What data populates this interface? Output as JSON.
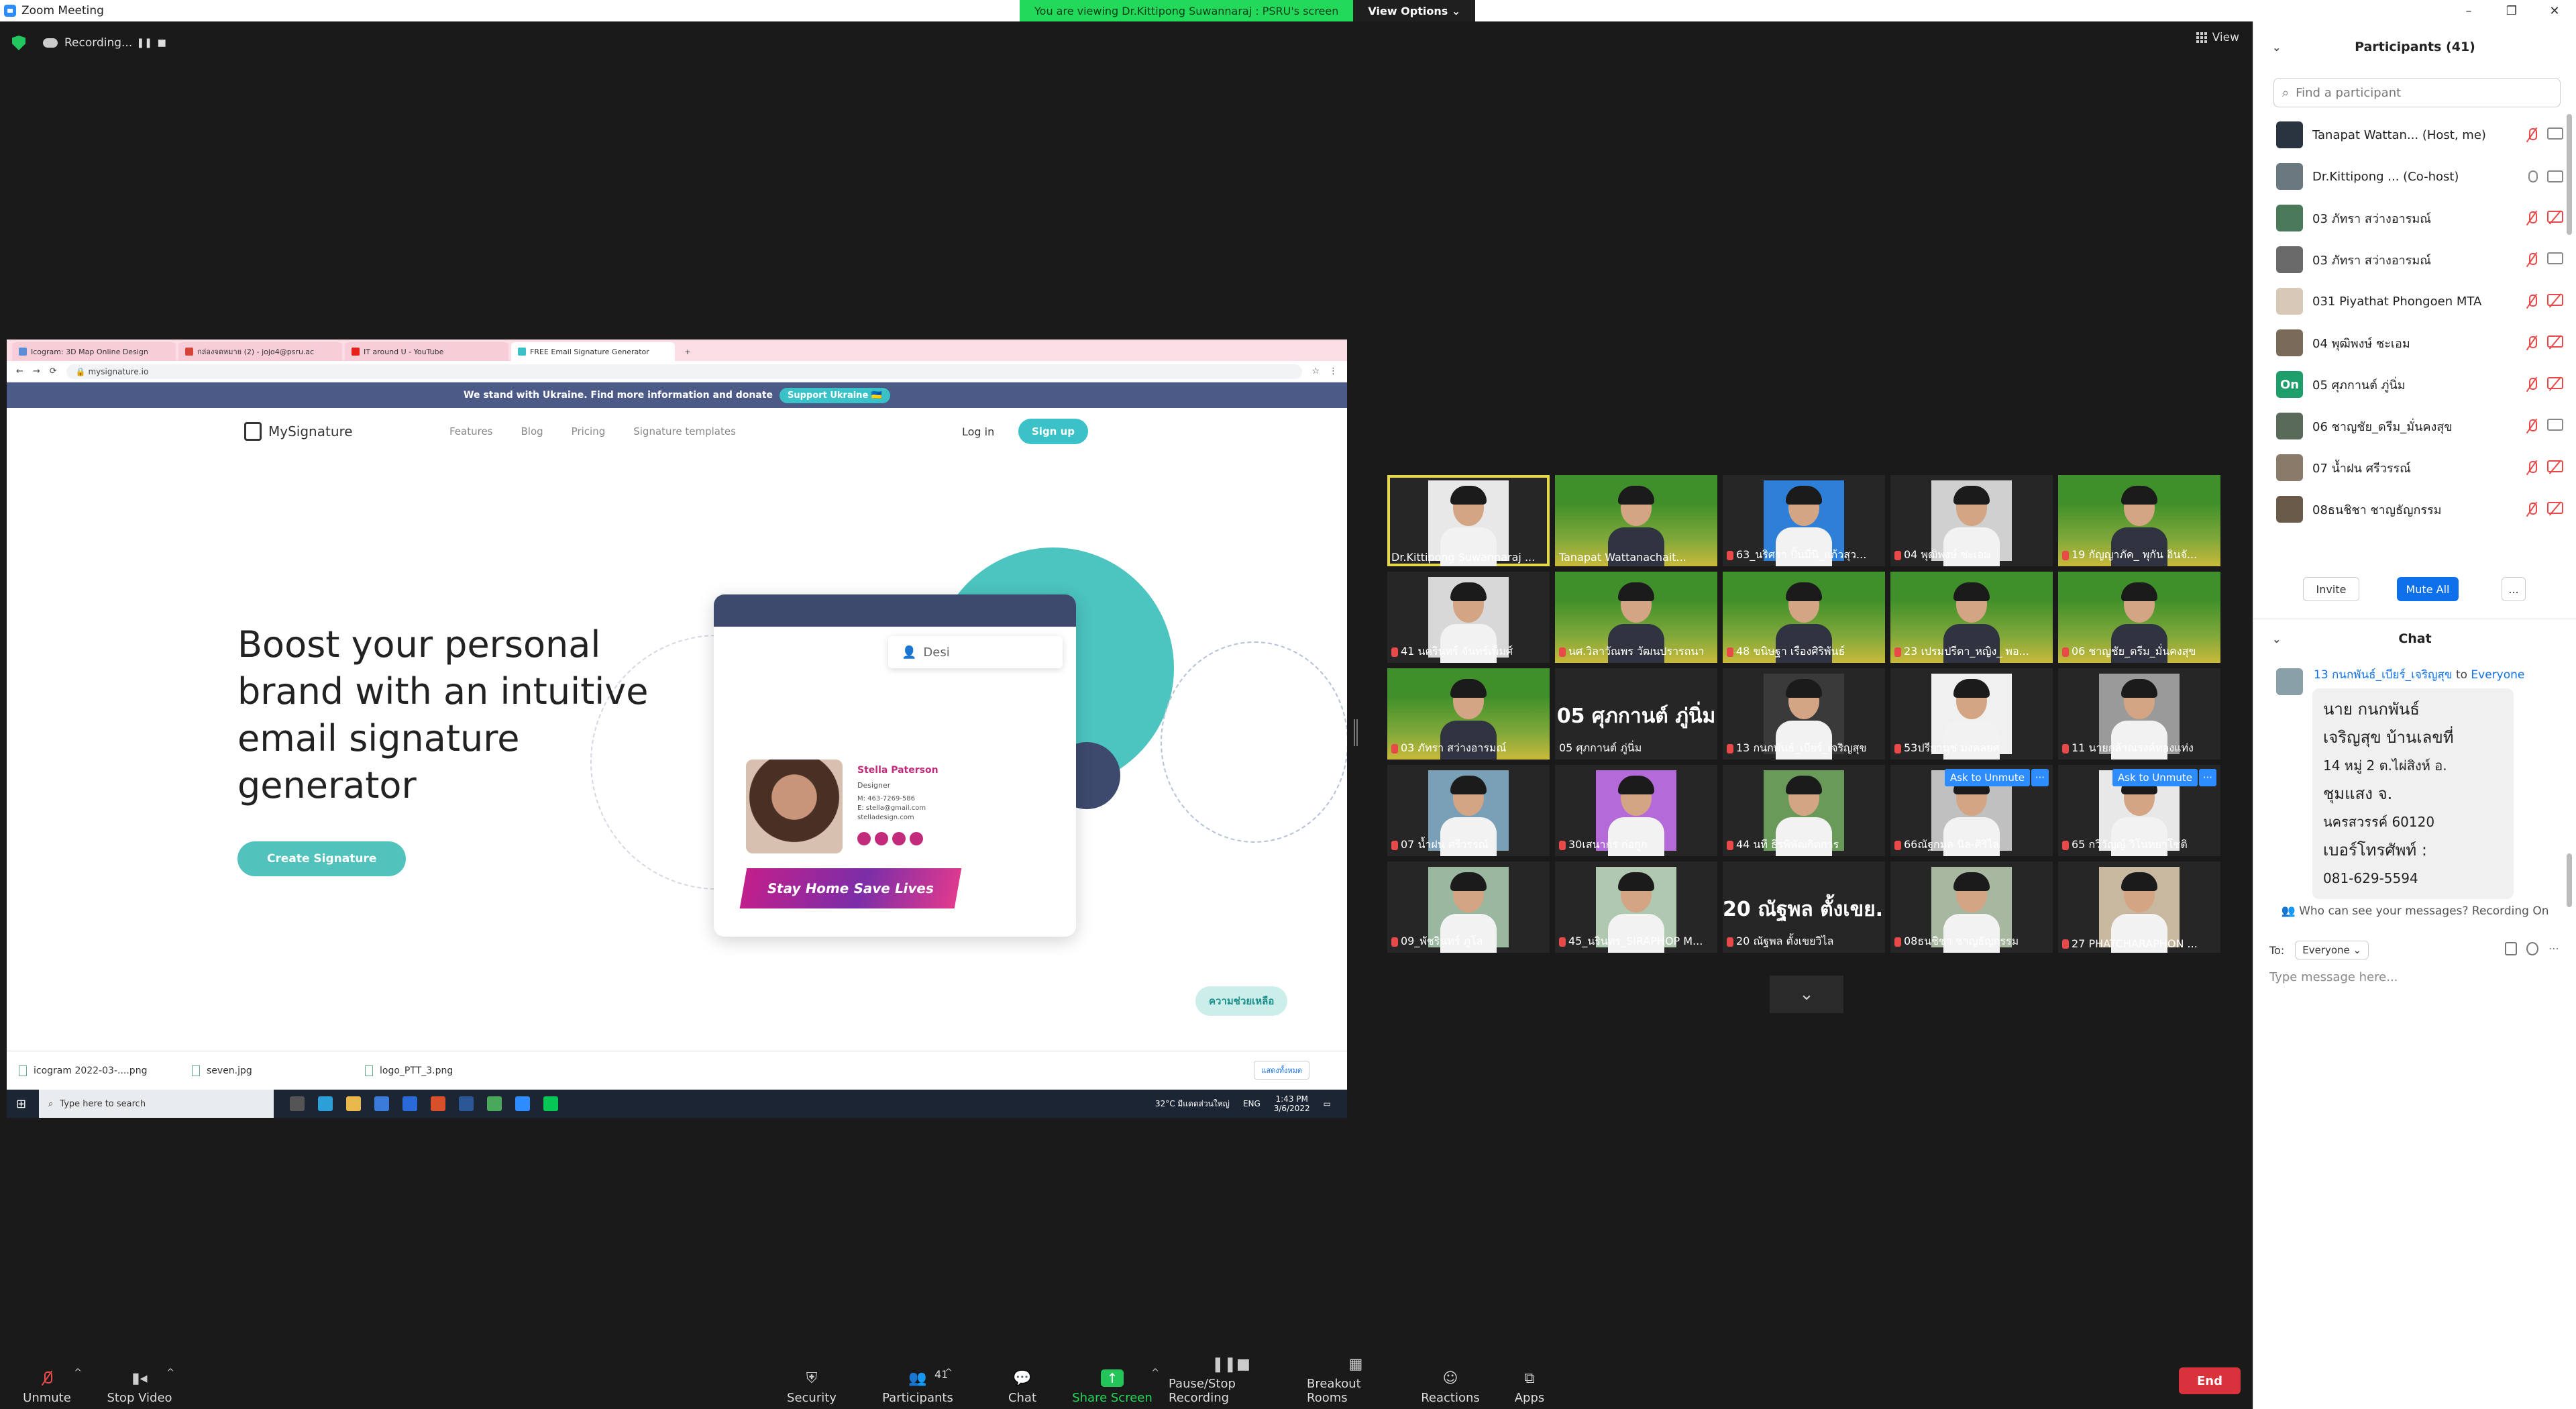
{
  "window": {
    "title": "Zoom Meeting",
    "controls": [
      "–",
      "❐",
      "✕"
    ]
  },
  "share_banner": {
    "viewing": "You are viewing Dr.Kittipong Suwannaraj : PSRU's screen",
    "view_options": "View Options ⌄"
  },
  "recording": {
    "label": "Recording...",
    "pause": "❚❚",
    "stop": "■"
  },
  "view_button": "View",
  "browser": {
    "tabs": [
      {
        "label": "Icogram: 3D Map Online Design",
        "fav": "#5a8fd8"
      },
      {
        "label": "กล่องจดหมาย (2) - jojo4@psru.ac",
        "fav": "#d64437"
      },
      {
        "label": "IT around U - YouTube",
        "fav": "#e62117"
      },
      {
        "label": "FREE Email Signature Generator",
        "fav": "#3ac2c8"
      }
    ],
    "address": "mysignature.io",
    "ukraine_text": "We stand with Ukraine. Find more information and donate",
    "ukraine_button": "Support Ukraine 🇺🇦"
  },
  "site": {
    "logo": "MySignature",
    "nav": [
      "Features",
      "Blog",
      "Pricing",
      "Signature templates"
    ],
    "login": "Log in",
    "signup": "Sign up",
    "hero_title": "Boost your personal brand with an intuitive email signature generator",
    "hero_button": "Create Signature",
    "search_text": "Desi",
    "sig_name": "Stella Paterson",
    "sig_role": "Designer",
    "sig_info": [
      "M:  463-7269-586",
      "E:  stella@gmail.com",
      "stelladesign.com"
    ],
    "sig_banner": "Stay Home Save Lives",
    "help_button": "ความช่วยเหลือ"
  },
  "downloads": {
    "items": [
      "icogram 2022-03-....png",
      "seven.jpg",
      "logo_PTT_3.png"
    ],
    "show_all": "แสดงทั้งหมด"
  },
  "taskbar": {
    "search": "Type here to search",
    "weather": "32°C  มีแดดส่วนใหญ่",
    "lang": "ENG",
    "time": "1:43 PM",
    "date": "3/6/2022"
  },
  "video_tiles": [
    {
      "name": "Dr.Kittipong Suwannaraj ...",
      "speaking": true,
      "muted": false,
      "style": "person",
      "bg": "#e8e8e8"
    },
    {
      "name": "Tanapat Wattanachait...",
      "muted": false,
      "style": "green"
    },
    {
      "name": "63_นริศรา  ปั้นมีนิ_แก้วสุว...",
      "muted": true,
      "style": "person",
      "bg": "#2e7fd8"
    },
    {
      "name": "04 พุฒิพงษ์ ชะเอม",
      "muted": true,
      "style": "person",
      "bg": "#d0d0d0"
    },
    {
      "name": "19 กัญญาภัค_ พุกัน อินจั...",
      "muted": true,
      "style": "green"
    },
    {
      "name": "41 นครินทร์ จันทร์เพ็มศ์",
      "muted": true,
      "style": "person",
      "bg": "#d8d8d8"
    },
    {
      "name": "นศ.วิลาวัณพร วัฒนปรารถนา",
      "muted": true,
      "style": "green"
    },
    {
      "name": "48 ขนิษฐา เรืองศิริพันธ์",
      "muted": true,
      "style": "green"
    },
    {
      "name": "23 เปรมปรีดา_หญิง_ พอ...",
      "muted": true,
      "style": "green"
    },
    {
      "name": "06 ชาญชัย_ดรีม_มั่นคงสุข",
      "muted": true,
      "style": "green"
    },
    {
      "name": "03 ภัทรา สว่างอารมณ์",
      "muted": true,
      "style": "green"
    },
    {
      "name": "05 ศุภกานต์ ภู่นิ่ม",
      "muted": false,
      "style": "text",
      "big": "05 ศุภกานต์ ภู่นิ่ม"
    },
    {
      "name": "13 กนกพันธ์_เบียร์_เจริญสุข",
      "muted": true,
      "style": "person",
      "bg": "#3a3a3a"
    },
    {
      "name": "53ปรียานุช มงคลยศ",
      "muted": true,
      "style": "person",
      "bg": "#f0f0f0"
    },
    {
      "name": "11 นายกล้าณรงค์ทองแท่ง",
      "muted": true,
      "style": "person",
      "bg": "#9a9a9a"
    },
    {
      "name": "07 น้ำฝน ศรีวรรณ์",
      "muted": true,
      "style": "person",
      "bg": "#7aa0b8"
    },
    {
      "name": "30เสนากร ก่อกูก",
      "muted": true,
      "style": "person",
      "bg": "#b46ad8"
    },
    {
      "name": "44 นที ธีรพิพัฒกิตการ",
      "muted": true,
      "style": "person",
      "bg": "#6a9a5a"
    },
    {
      "name": "66ณัฐกมล นิล-ศิริไล",
      "muted": true,
      "style": "person",
      "bg": "#c0c0c0",
      "ask": "Ask to Unmute",
      "more": "···"
    },
    {
      "name": "65 กวีวัญญ์ วิโนทยาโชติ",
      "muted": true,
      "style": "person",
      "bg": "#e8e8e8",
      "ask": "Ask to Unmute",
      "more": "···"
    },
    {
      "name": "09_พัชรินทร์ ภูโล",
      "muted": true,
      "style": "person",
      "bg": "#9ab8a0"
    },
    {
      "name": "45_นรินทร_SIRAPHOP M...",
      "muted": true,
      "style": "person",
      "bg": "#b0c8b0"
    },
    {
      "name": "20 ณัฐพล ตั้งเขยวิไล",
      "muted": true,
      "style": "text",
      "big": "20 ณัฐพล ตั้งเขย..."
    },
    {
      "name": "08ธนชิชา ชาญธัญกรรม",
      "muted": true,
      "style": "person",
      "bg": "#a8b8a0"
    },
    {
      "name": "27 PHATCHARAPHON ...",
      "muted": true,
      "style": "person",
      "bg": "#c8b8a0"
    }
  ],
  "grid_down": "⌄",
  "toolbar": {
    "unmute": "Unmute",
    "stop_video": "Stop Video",
    "security": "Security",
    "participants": "Participants",
    "participants_count": "41",
    "chat": "Chat",
    "share_screen": "Share Screen",
    "pause_recording": "Pause/Stop Recording",
    "breakout": "Breakout Rooms",
    "reactions": "Reactions",
    "apps": "Apps",
    "end": "End"
  },
  "participants_panel": {
    "title": "Participants (41)",
    "search_placeholder": "Find a participant",
    "rows": [
      {
        "name": "Tanapat Wattan...  (Host, me)",
        "avatar": "",
        "av_bg": "#2a3440",
        "mic": "off",
        "cam": "on"
      },
      {
        "name": "Dr.Kittipong ... (Co-host)",
        "avatar": "",
        "av_bg": "#6a7880",
        "mic": "on",
        "cam": "on"
      },
      {
        "name": "03 ภัทรา สว่างอารมณ์",
        "avatar": "",
        "av_bg": "#4a7a5a",
        "mic": "off",
        "cam": "off"
      },
      {
        "name": "03 ภัทรา สว่างอารมณ์",
        "avatar": "",
        "av_bg": "#6a6a6a",
        "mic": "off",
        "cam": "on"
      },
      {
        "name": "031 Piyathat Phongoen MTA",
        "avatar": "",
        "av_bg": "#d8c8b8",
        "mic": "off",
        "cam": "off"
      },
      {
        "name": "04 พุฒิพงษ์ ชะเอม",
        "avatar": "",
        "av_bg": "#7a6a5a",
        "mic": "off",
        "cam": "off"
      },
      {
        "name": "05 ศุภกานต์ ภู่นิ่ม",
        "avatar": "On",
        "av_bg": "#1d9e6a",
        "mic": "off",
        "cam": "off"
      },
      {
        "name": "06 ชาญชัย_ดรีม_มั่นคงสุข",
        "avatar": "",
        "av_bg": "#5a6a5a",
        "mic": "off",
        "cam": "on"
      },
      {
        "name": "07 น้ำฝน ศรีวรรณ์",
        "avatar": "",
        "av_bg": "#8a7a6a",
        "mic": "off",
        "cam": "off"
      },
      {
        "name": "08ธนชิชา ชาญธัญกรรม",
        "avatar": "",
        "av_bg": "#6a5a4a",
        "mic": "off",
        "cam": "off"
      }
    ],
    "invite": "Invite",
    "mute_all": "Mute All",
    "more": "..."
  },
  "chat": {
    "title": "Chat",
    "sender": "13 กนกพันธ์_เบียร์_เจริญสุข",
    "to_word": "to",
    "recipient": "Everyone",
    "message_lines": [
      {
        "text": "นาย กนกพันธ์",
        "small": false
      },
      {
        "text": "เจริญสุข บ้านเลขที่",
        "small": false
      },
      {
        "text": "14 หมู่ 2 ต.ไผ่สิงห์ อ.",
        "small": true
      },
      {
        "text": "ชุมแสง จ.",
        "small": false
      },
      {
        "text": "นครสวรรค์ 60120",
        "small": true
      },
      {
        "text": "เบอร์โทรศัพท์ :",
        "small": false
      },
      {
        "text": "081-629-5594",
        "small": true
      }
    ],
    "who_can_see": "Who can see your messages? Recording On",
    "to_label": "To:",
    "to_select": "Everyone ⌄",
    "input_placeholder": "Type message here..."
  },
  "colors": {
    "accent": "#0e71eb",
    "share_green": "#23d959",
    "end_red": "#d8323c",
    "muted_red": "#e84a4a",
    "speaker_yellow": "#e5d84a",
    "brand_teal": "#3ac2c8"
  }
}
